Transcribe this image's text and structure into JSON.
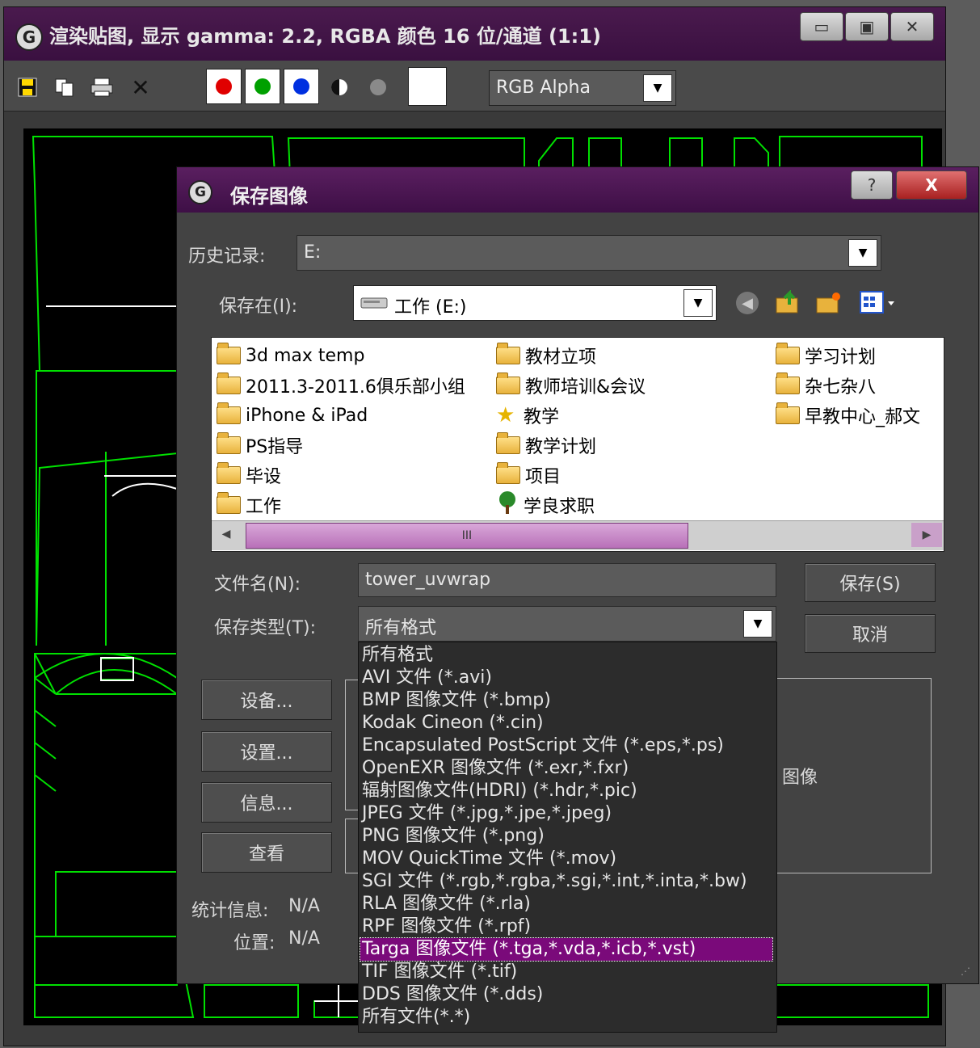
{
  "render_window": {
    "title": "渲染贴图, 显示 gamma: 2.2, RGBA 颜色 16 位/通道 (1:1)",
    "channel_select": "RGB Alpha",
    "window_buttons": [
      "▭",
      "▣",
      "✕"
    ],
    "accent_title_color": "#4a1a4e",
    "toolbar_icons": [
      "save-icon",
      "copy-icon",
      "print-icon",
      "clear-icon"
    ],
    "channel_colors": [
      "#e00000",
      "#00a000",
      "#0030e0"
    ]
  },
  "dialog": {
    "title": "保存图像",
    "help_btn": "?",
    "close_btn": "X",
    "history_label": "历史记录:",
    "history_value": "E:",
    "save_in_label": "保存在(I):",
    "save_in_value": "工作 (E:)",
    "files": [
      {
        "name": "3d max temp",
        "icon": "folder"
      },
      {
        "name": "2011.3-2011.6俱乐部小组",
        "icon": "folder"
      },
      {
        "name": "iPhone & iPad",
        "icon": "folder"
      },
      {
        "name": "PS指导",
        "icon": "folder"
      },
      {
        "name": "毕设",
        "icon": "folder"
      },
      {
        "name": "工作",
        "icon": "folder"
      },
      {
        "name": "教材立项",
        "icon": "folder"
      },
      {
        "name": "教师培训&会议",
        "icon": "folder"
      },
      {
        "name": "教学",
        "icon": "star"
      },
      {
        "name": "教学计划",
        "icon": "folder"
      },
      {
        "name": "项目",
        "icon": "folder"
      },
      {
        "name": "学良求职",
        "icon": "tree"
      },
      {
        "name": "学习计划",
        "icon": "folder"
      },
      {
        "name": "杂七杂八",
        "icon": "folder"
      },
      {
        "name": "早教中心_郝文",
        "icon": "folder"
      }
    ],
    "scroll_grip": "III",
    "filename_label": "文件名(N):",
    "filename_value": "tower_uvwrap",
    "type_label": "保存类型(T):",
    "type_value": "所有格式",
    "save_button": "保存(S)",
    "cancel_button": "取消",
    "devices_button": "设备...",
    "setup_button": "设置...",
    "info_button": "信息...",
    "view_button": "查看",
    "image_label": "图像",
    "stats_label": "统计信息:",
    "stats_value": "N/A",
    "location_label": "位置:",
    "location_value": "N/A",
    "type_options": [
      "所有格式",
      "AVI 文件 (*.avi)",
      "BMP 图像文件 (*.bmp)",
      "Kodak Cineon (*.cin)",
      "Encapsulated PostScript 文件 (*.eps,*.ps)",
      "OpenEXR 图像文件 (*.exr,*.fxr)",
      "辐射图像文件(HDRI) (*.hdr,*.pic)",
      "JPEG 文件 (*.jpg,*.jpe,*.jpeg)",
      "PNG 图像文件 (*.png)",
      "MOV QuickTime 文件 (*.mov)",
      "SGI 文件 (*.rgb,*.rgba,*.sgi,*.int,*.inta,*.bw)",
      "RLA 图像文件 (*.rla)",
      "RPF 图像文件 (*.rpf)",
      "Targa 图像文件 (*.tga,*.vda,*.icb,*.vst)",
      "TIF 图像文件 (*.tif)",
      "DDS 图像文件 (*.dds)",
      "所有文件(*.*)"
    ],
    "selected_option_index": 13,
    "selected_color": "#7a0a7a"
  }
}
